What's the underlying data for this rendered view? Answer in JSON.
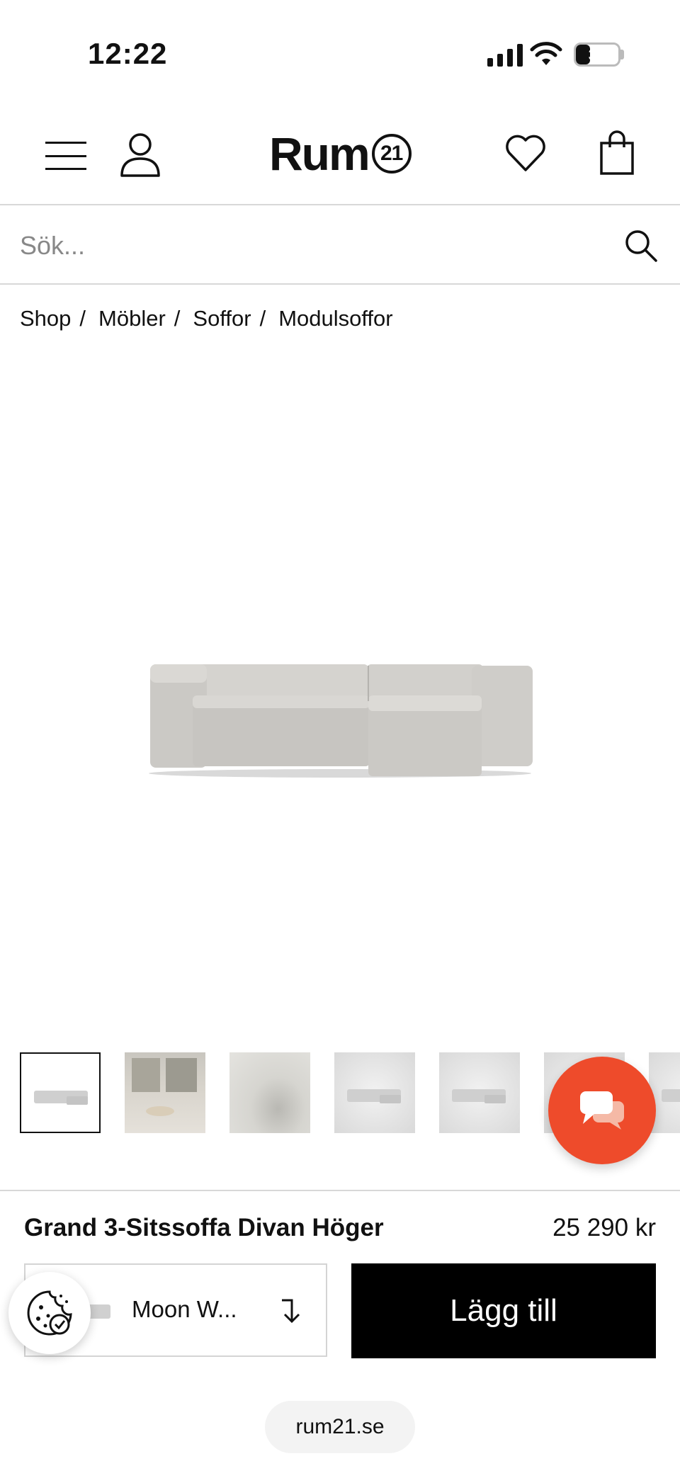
{
  "status_bar": {
    "time": "12:22",
    "battery_level": "33",
    "battery_fraction": 0.33
  },
  "header": {
    "logo_text": "Rum",
    "logo_badge": "21"
  },
  "search": {
    "placeholder": "Sök..."
  },
  "breadcrumb": [
    {
      "label": "Shop"
    },
    {
      "label": "Möbler"
    },
    {
      "label": "Soffor"
    },
    {
      "label": "Modulsoffor"
    }
  ],
  "product": {
    "title": "Grand 3-Sitssoffa Divan Höger",
    "price": "25 290 kr",
    "variant_label": "Moon W...",
    "add_button_label": "Lägg till"
  },
  "browser": {
    "url": "rum21.se"
  },
  "colors": {
    "chat_accent": "#ee4b2b",
    "cta_background": "#000000"
  },
  "icons": [
    "menu-icon",
    "user-icon",
    "heart-icon",
    "bag-icon",
    "search-icon",
    "chat-icon",
    "cookie-icon",
    "chevron-down-icon"
  ]
}
